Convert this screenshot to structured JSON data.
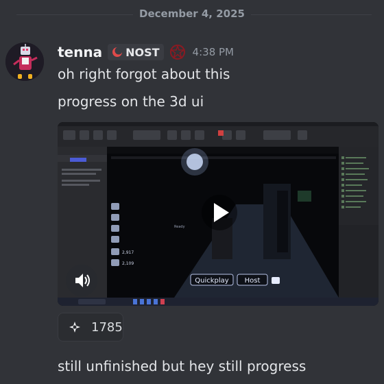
{
  "date_divider": "December 4, 2025",
  "message": {
    "username": "tenna",
    "server_tag": "NOST",
    "timestamp": "4:38 PM",
    "lines": [
      "oh right forgot about this",
      "progress on the 3d ui"
    ],
    "followup": "still unfinished but hey still progress"
  },
  "video": {
    "hud_buttons": [
      "Quickplay",
      "Host"
    ],
    "hud_label_top": "Ready",
    "hud_counts": [
      "2,917",
      "2,109"
    ]
  },
  "reaction": {
    "emoji": "sparkle-emoji",
    "count": "1785"
  },
  "colors": {
    "background": "#313338",
    "text": "#dbdee1",
    "muted": "#949ba4",
    "accent": "#5865f2"
  }
}
